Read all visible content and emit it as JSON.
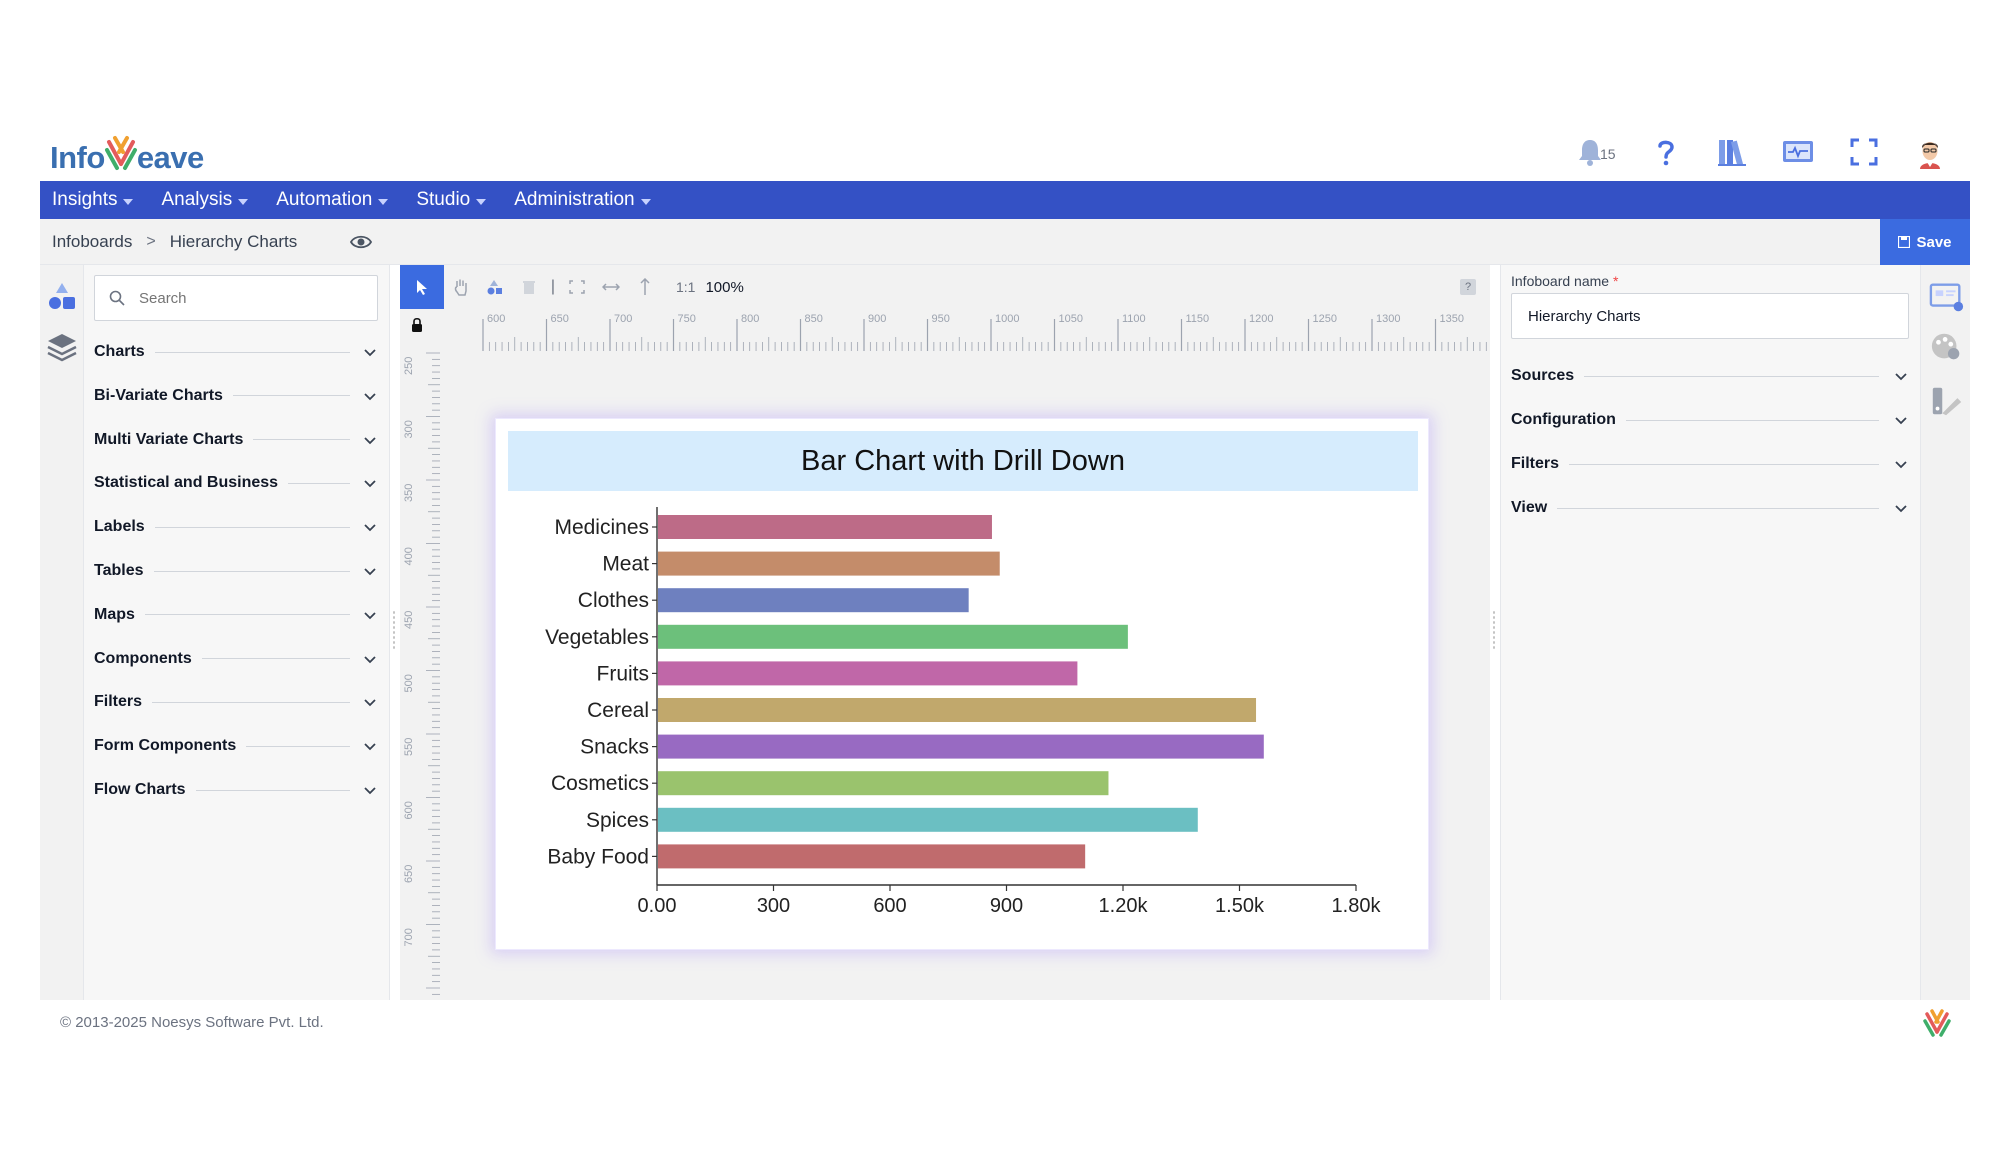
{
  "app": {
    "logo_text_left": "Info",
    "logo_text_right": "eave",
    "brand_color": "#3451c5",
    "accent_color": "#3b6be0"
  },
  "header": {
    "notification_count": "15",
    "icons": [
      "bell-icon",
      "help-icon",
      "library-icon",
      "monitor-icon",
      "fullscreen-icon",
      "user-avatar"
    ]
  },
  "nav": {
    "items": [
      {
        "label": "Insights"
      },
      {
        "label": "Analysis"
      },
      {
        "label": "Automation"
      },
      {
        "label": "Studio"
      },
      {
        "label": "Administration"
      }
    ]
  },
  "breadcrumb": {
    "items": [
      "Infoboards",
      "Hierarchy Charts"
    ],
    "separator": ">"
  },
  "toolbar": {
    "save_label": "Save",
    "zoom_ratio": "1:1",
    "zoom_value": "100%"
  },
  "components": {
    "search_placeholder": "Search",
    "categories": [
      "Charts",
      "Bi-Variate Charts",
      "Multi Variate Charts",
      "Statistical and Business",
      "Labels",
      "Tables",
      "Maps",
      "Components",
      "Filters",
      "Form Components",
      "Flow Charts"
    ]
  },
  "ruler": {
    "horizontal": [
      "600",
      "650",
      "700",
      "750",
      "800",
      "850",
      "900",
      "950",
      "1000",
      "1050",
      "1100",
      "1150",
      "1200",
      "1250",
      "1300",
      "1350"
    ],
    "vertical": [
      "250",
      "300",
      "350",
      "400",
      "450",
      "500",
      "550",
      "600",
      "650",
      "700"
    ]
  },
  "properties": {
    "infoboard_name_label": "Infoboard name",
    "required_mark": "*",
    "infoboard_name_value": "Hierarchy Charts",
    "sections": [
      "Sources",
      "Configuration",
      "Filters",
      "View"
    ]
  },
  "footer": {
    "copyright": "© 2013-2025 Noesys Software Pvt. Ltd."
  },
  "chart_data": {
    "type": "bar",
    "orientation": "horizontal",
    "title": "Bar Chart with Drill Down",
    "categories": [
      "Medicines",
      "Meat",
      "Clothes",
      "Vegetables",
      "Fruits",
      "Cereal",
      "Snacks",
      "Cosmetics",
      "Spices",
      "Baby Food"
    ],
    "values": [
      860,
      880,
      800,
      1210,
      1080,
      1540,
      1560,
      1160,
      1390,
      1100
    ],
    "colors": [
      "#bd6b87",
      "#c48c6a",
      "#6e80bf",
      "#6cc07b",
      "#c067a8",
      "#c1a86c",
      "#986ac2",
      "#9ac36d",
      "#6bbfc2",
      "#c06b6d"
    ],
    "x_ticks": [
      "0.00",
      "300",
      "600",
      "900",
      "1.20k",
      "1.50k",
      "1.80k"
    ],
    "xlim": [
      0,
      1800
    ],
    "grid": false,
    "legend": "none"
  }
}
